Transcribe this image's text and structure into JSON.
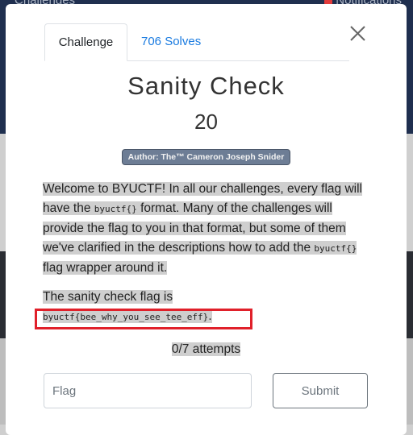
{
  "background": {
    "nav_left": "Challenges",
    "nav_right": "Notifications"
  },
  "tabs": [
    {
      "label": "Challenge",
      "active": true
    },
    {
      "label": "706 Solves",
      "active": false
    }
  ],
  "challenge": {
    "title": "Sanity Check",
    "points": "20",
    "author": "Author: The™ Cameron Joseph Snider",
    "description": {
      "p1_a": "Welcome to BYUCTF! In all our challenges, every flag will have the ",
      "p1_code1": "byuctf{}",
      "p1_b": " format. Many of the challenges will provide the flag to you in that format, but some of them we've clarified in the descriptions how to add the ",
      "p1_code2": "byuctf{}",
      "p1_c": " flag wrapper around it.",
      "p2_a": "The sanity check flag is",
      "p2_flag": "byuctf{bee_why_you_see_tee_eff}",
      "p2_end": "."
    },
    "attempts": "0/7 attempts"
  },
  "form": {
    "flag_placeholder": "Flag",
    "flag_value": "",
    "submit_label": "Submit"
  },
  "colors": {
    "tab_link": "#1a7be0",
    "highlight_box": "#e0202a",
    "author_badge": "#6d7d95"
  }
}
